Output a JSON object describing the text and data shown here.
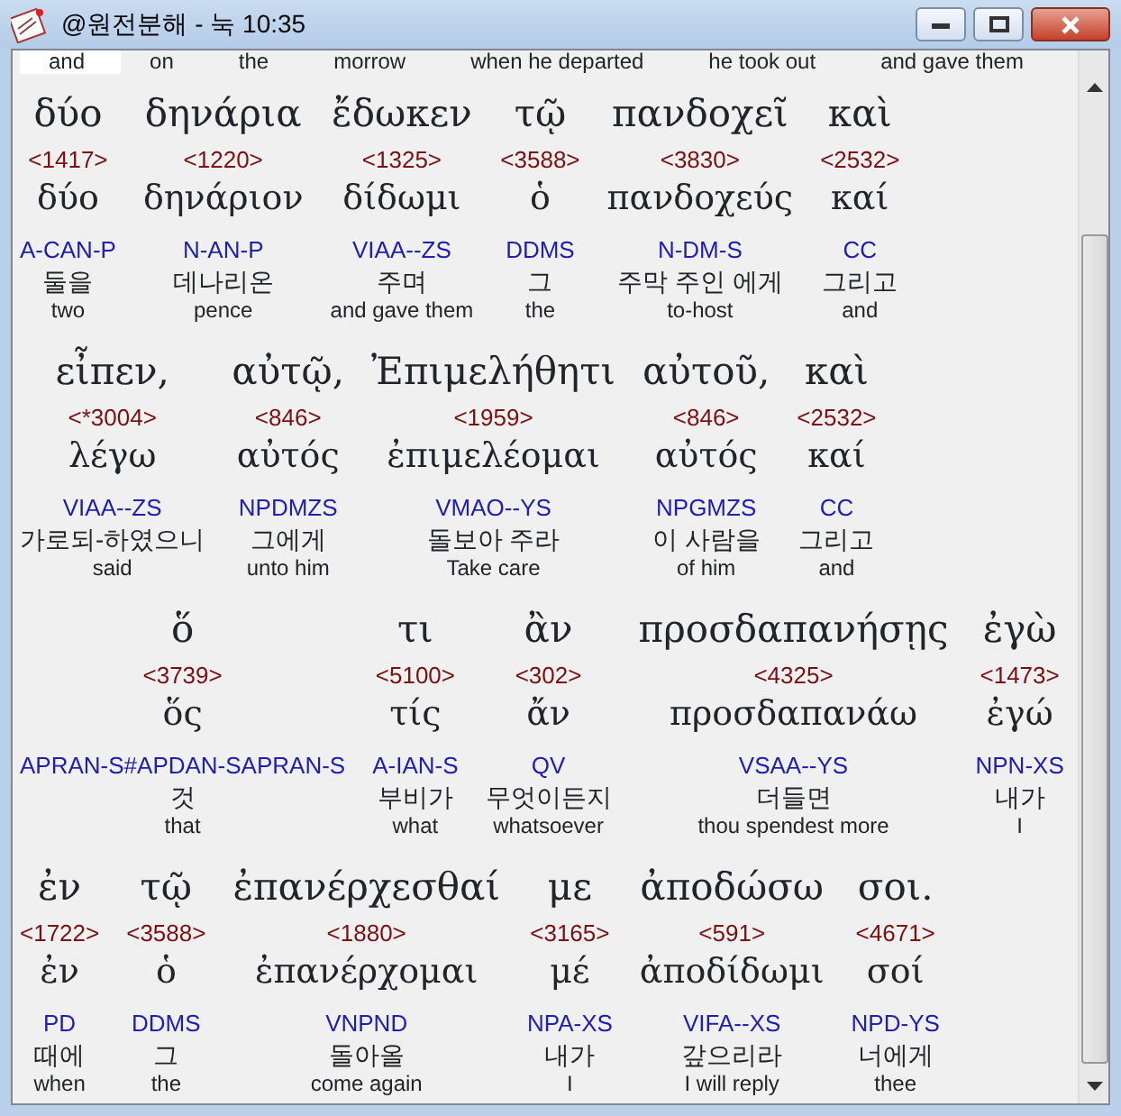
{
  "window": {
    "title": "@원전분해 - 눅 10:35"
  },
  "top_row": [
    {
      "english": "and",
      "selected": true
    },
    {
      "english": "on",
      "selected": false
    },
    {
      "english": "the",
      "selected": false
    },
    {
      "english": "morrow",
      "selected": false
    },
    {
      "english": "when he departed",
      "selected": false
    },
    {
      "english": "he took out",
      "selected": false
    },
    {
      "english": "and gave them",
      "selected": false
    }
  ],
  "lines": [
    {
      "words": [
        {
          "greek": "δύο",
          "strongs": "<1417>",
          "lemma": "δύο",
          "parse": "A-CAN-P",
          "korean": "둘을",
          "english": "two"
        },
        {
          "greek": "δηνάρια",
          "strongs": "<1220>",
          "lemma": "δηνάριον",
          "parse": "N-AN-P",
          "korean": "데나리온",
          "english": "pence"
        },
        {
          "greek": "ἔδωκεν",
          "strongs": "<1325>",
          "lemma": "δίδωμι",
          "parse": "VIAA--ZS",
          "korean": "주며",
          "english": "and gave them"
        },
        {
          "greek": "τῷ",
          "strongs": "<3588>",
          "lemma": "ὁ",
          "parse": "DDMS",
          "korean": "그",
          "english": "the"
        },
        {
          "greek": "πανδοχεῖ",
          "strongs": "<3830>",
          "lemma": "πανδοχεύς",
          "parse": "N-DM-S",
          "korean": "주막 주인 에게",
          "english": "to-host"
        },
        {
          "greek": "καὶ",
          "strongs": "<2532>",
          "lemma": "καί",
          "parse": "CC",
          "korean": "그리고",
          "english": "and"
        }
      ]
    },
    {
      "words": [
        {
          "greek": "εἶπεν,",
          "strongs": "<*3004>",
          "lemma": "λέγω",
          "parse": "VIAA--ZS",
          "korean": "가로되-하였으니",
          "english": "said"
        },
        {
          "greek": "αὐτῷ,",
          "strongs": "<846>",
          "lemma": "αὐτός",
          "parse": "NPDMZS",
          "korean": "그에게",
          "english": "unto him"
        },
        {
          "greek": "Ἐπιμελήθητι",
          "strongs": "<1959>",
          "lemma": "ἐπιμελέομαι",
          "parse": "VMAO--YS",
          "korean": "돌보아 주라",
          "english": "Take care"
        },
        {
          "greek": "αὐτοῦ,",
          "strongs": "<846>",
          "lemma": "αὐτός",
          "parse": "NPGMZS",
          "korean": "이 사람을",
          "english": "of him"
        },
        {
          "greek": "καὶ",
          "strongs": "<2532>",
          "lemma": "καί",
          "parse": "CC",
          "korean": "그리고",
          "english": "and"
        }
      ]
    },
    {
      "words": [
        {
          "greek": "ὅ",
          "strongs": "<3739>",
          "lemma": "ὅς",
          "parse": "APRAN-S#APDAN-SAPRAN-S",
          "korean": "것",
          "english": "that"
        },
        {
          "greek": "τι",
          "strongs": "<5100>",
          "lemma": "τίς",
          "parse": "A-IAN-S",
          "korean": "부비가",
          "english": "what"
        },
        {
          "greek": "ἂν",
          "strongs": "<302>",
          "lemma": "ἄν",
          "parse": "QV",
          "korean": "무엇이든지",
          "english": "whatsoever"
        },
        {
          "greek": "προσδαπανήσῃς",
          "strongs": "<4325>",
          "lemma": "προσδαπανάω",
          "parse": "VSAA--YS",
          "korean": "더들면",
          "english": "thou spendest more"
        },
        {
          "greek": "ἐγὼ",
          "strongs": "<1473>",
          "lemma": "ἐγώ",
          "parse": "NPN-XS",
          "korean": "내가",
          "english": "I"
        }
      ]
    },
    {
      "words": [
        {
          "greek": "ἐν",
          "strongs": "<1722>",
          "lemma": "ἐν",
          "parse": "PD",
          "korean": "때에",
          "english": "when"
        },
        {
          "greek": "τῷ",
          "strongs": "<3588>",
          "lemma": "ὁ",
          "parse": "DDMS",
          "korean": "그",
          "english": "the"
        },
        {
          "greek": "ἐπανέρχεσθαί",
          "strongs": "<1880>",
          "lemma": "ἐπανέρχομαι",
          "parse": "VNPND",
          "korean": "돌아올",
          "english": "come again"
        },
        {
          "greek": "με",
          "strongs": "<3165>",
          "lemma": "μέ",
          "parse": "NPA-XS",
          "korean": "내가",
          "english": "I"
        },
        {
          "greek": "ἀποδώσω",
          "strongs": "<591>",
          "lemma": "ἀποδίδωμι",
          "parse": "VIFA--XS",
          "korean": "갚으리라",
          "english": "I will reply"
        },
        {
          "greek": "σοι.",
          "strongs": "<4671>",
          "lemma": "σοί",
          "parse": "NPD-YS",
          "korean": "너에게",
          "english": "thee"
        }
      ]
    }
  ]
}
